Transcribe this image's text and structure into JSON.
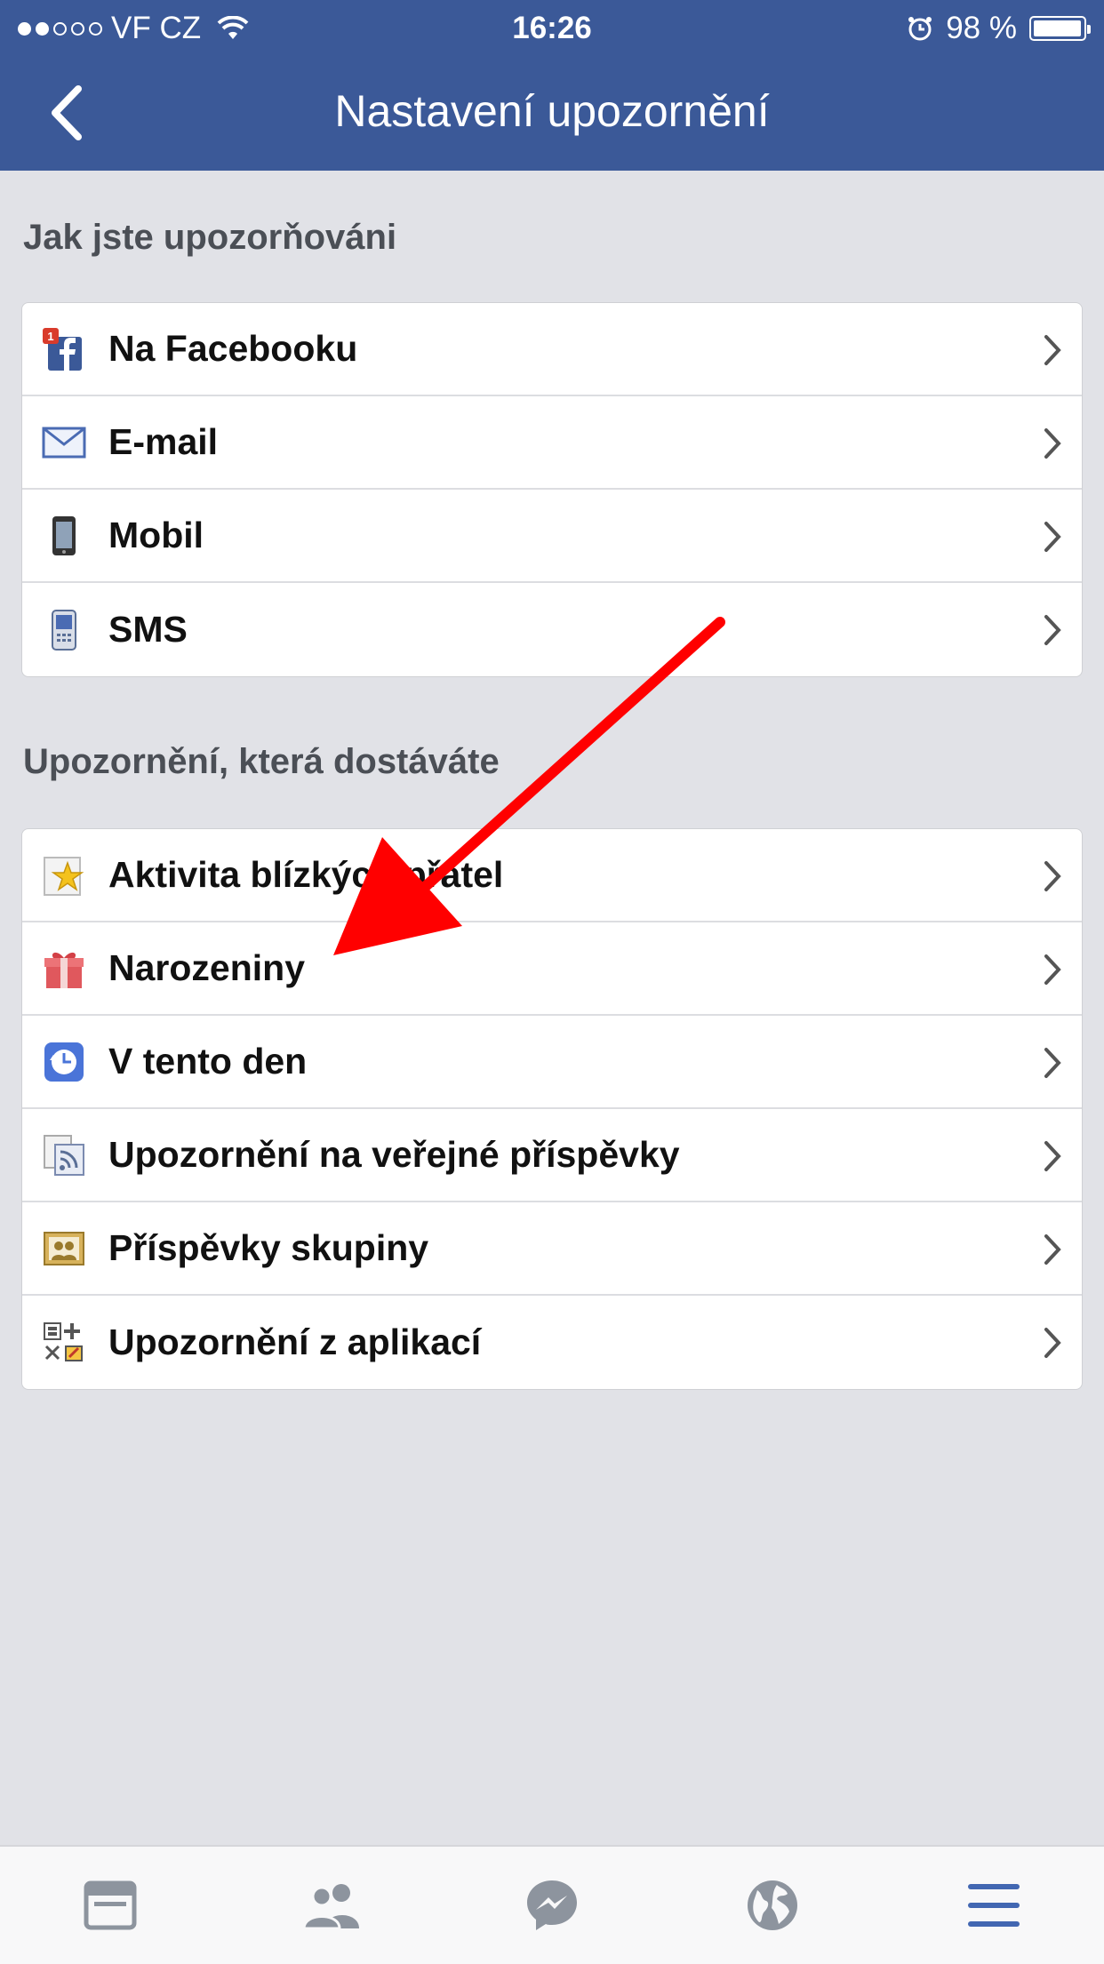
{
  "status_bar": {
    "carrier": "VF CZ",
    "time": "16:26",
    "battery": "98 %",
    "battery_level": 0.98,
    "signal_bars": 2
  },
  "nav": {
    "title": "Nastavení upozornění",
    "back_icon": "chevron-left-icon"
  },
  "sections": [
    {
      "title": "Jak jste upozorňováni",
      "items": [
        {
          "label": "Na Facebooku",
          "icon": "facebook-notification-icon"
        },
        {
          "label": "E-mail",
          "icon": "envelope-icon"
        },
        {
          "label": "Mobil",
          "icon": "mobile-phone-icon"
        },
        {
          "label": "SMS",
          "icon": "sms-phone-icon"
        }
      ]
    },
    {
      "title": "Upozornění, která dostáváte",
      "items": [
        {
          "label": "Aktivita blízkých přátel",
          "icon": "star-icon"
        },
        {
          "label": "Narozeniny",
          "icon": "gift-icon"
        },
        {
          "label": "V tento den",
          "icon": "clock-history-icon"
        },
        {
          "label": "Upozornění na veřejné příspěvky",
          "icon": "rss-feed-icon"
        },
        {
          "label": "Příspěvky skupiny",
          "icon": "group-photo-icon"
        },
        {
          "label": "Upozornění z aplikací",
          "icon": "apps-icon"
        }
      ]
    }
  ],
  "tabbar": [
    {
      "name": "news-feed-tab",
      "icon": "news-feed-icon"
    },
    {
      "name": "friends-tab",
      "icon": "friends-icon"
    },
    {
      "name": "messenger-tab",
      "icon": "messenger-icon"
    },
    {
      "name": "notifications-tab",
      "icon": "globe-icon"
    },
    {
      "name": "menu-tab",
      "icon": "menu-icon",
      "active": true
    }
  ],
  "colors": {
    "header": "#3b5998",
    "background": "#e1e2e7",
    "tab_active": "#4267b2",
    "tab_inactive": "#8d949e",
    "annotation_arrow": "#ff0000"
  }
}
